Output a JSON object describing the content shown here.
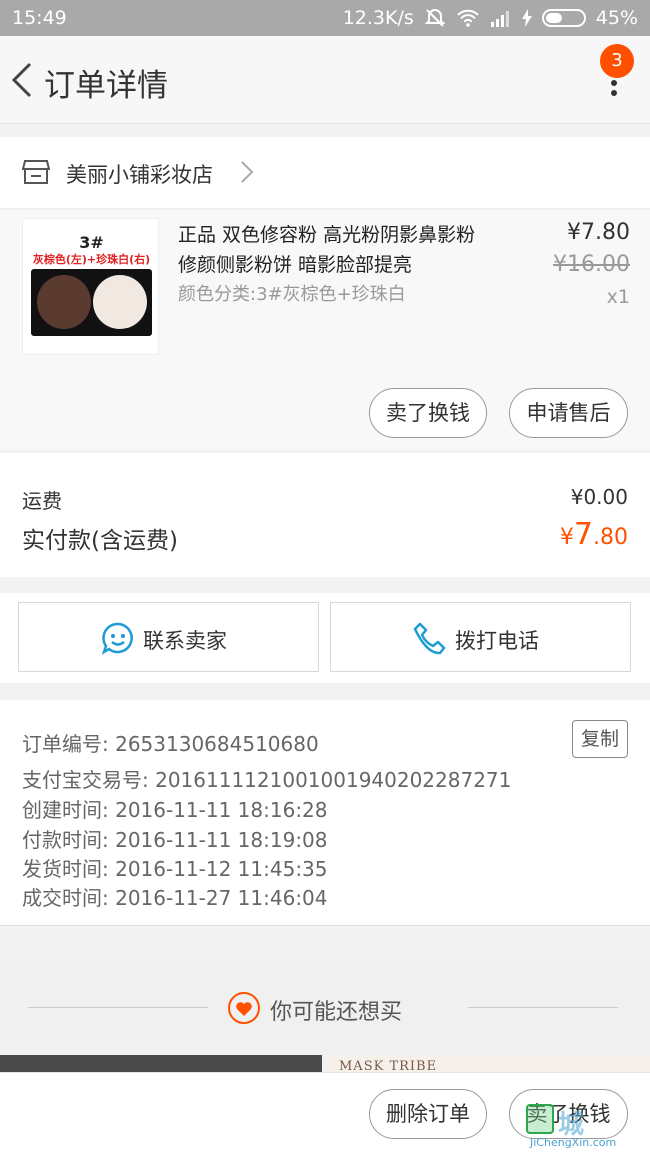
{
  "status_bar": {
    "time": "15:49",
    "network_speed": "12.3K/s",
    "battery": "45%",
    "battery_level": 0.45
  },
  "header": {
    "title": "订单详情",
    "badge_count": "3"
  },
  "shop": {
    "name": "美丽小铺彩妆店"
  },
  "item": {
    "thumb_number": "3#",
    "thumb_caption": "灰棕色(左)+珍珠白(右)",
    "title": "正品 双色修容粉 高光粉阴影鼻影粉 修颜侧影粉饼 暗影脸部提亮",
    "spec": "颜色分类:3#灰棕色+珍珠白",
    "price": "¥7.80",
    "original_price": "¥16.00",
    "quantity": "x1",
    "sell_button": "卖了换钱",
    "after_sale_button": "申请售后"
  },
  "fees": {
    "shipping_label": "运费",
    "shipping_value": "¥0.00",
    "paid_label": "实付款(含运费)",
    "paid_currency": "¥",
    "paid_int": "7",
    "paid_dec": ".80"
  },
  "contact": {
    "seller_label": "联系卖家",
    "phone_label": "拨打电话"
  },
  "order_info": {
    "order_no": "订单编号: 2653130684510680",
    "copy_label": "复制",
    "alipay_no": "支付宝交易号: 2016111121001001940202287271",
    "created": "创建时间: 2016-11-11 18:16:28",
    "paid": "付款时间: 2016-11-11 18:19:08",
    "shipped": "发货时间: 2016-11-12 11:45:35",
    "completed": "成交时间: 2016-11-27 11:46:04"
  },
  "recommend": {
    "title": "你可能还想买",
    "brand": "MASK TRIBE"
  },
  "bottom": {
    "delete_label": "删除订单",
    "sell_label": "卖了换钱"
  },
  "watermark": {
    "text": "城",
    "site": "JiChengXin.com"
  },
  "colors": {
    "accent": "#ff5000",
    "icon_blue": "#1d9bd6"
  }
}
